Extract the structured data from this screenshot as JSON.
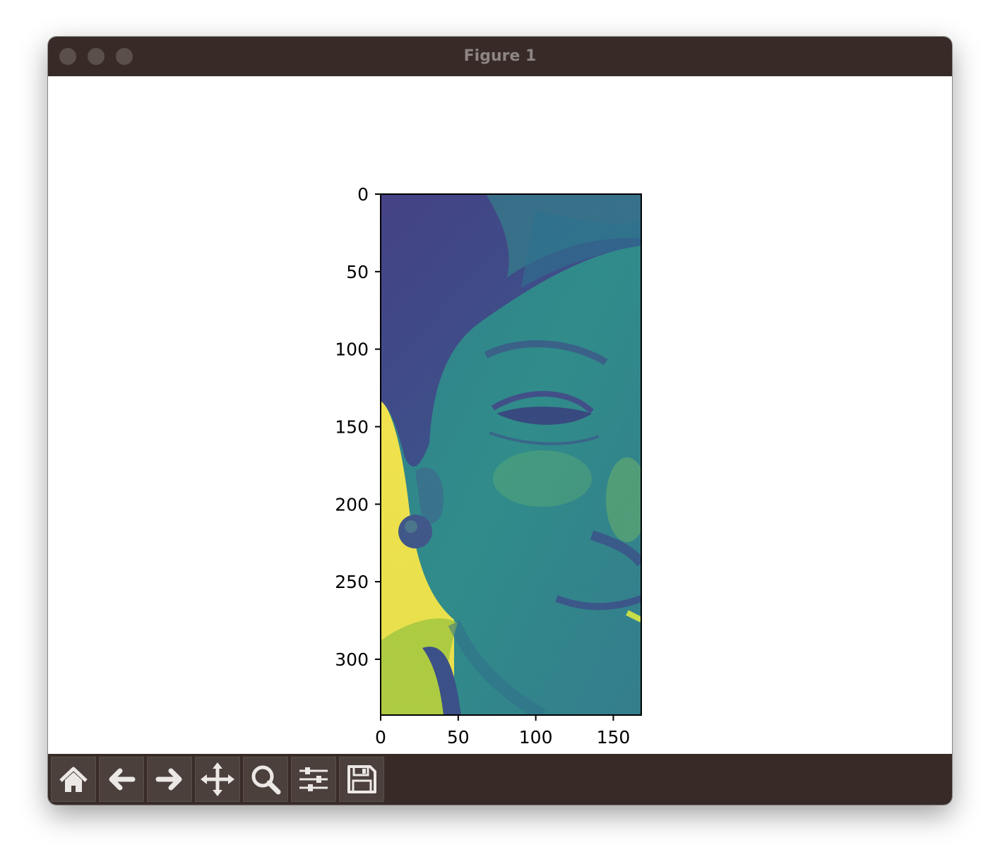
{
  "window": {
    "title": "Figure 1"
  },
  "chart_data": {
    "type": "image",
    "colormap": "viridis",
    "image_shape": [
      336,
      168
    ],
    "xlim": [
      0,
      168
    ],
    "ylim": [
      336,
      0
    ],
    "xticks": [
      0,
      50,
      100,
      150
    ],
    "yticks": [
      0,
      50,
      100,
      150,
      200,
      250,
      300
    ],
    "xtick_labels": [
      "0",
      "50",
      "100",
      "150"
    ],
    "ytick_labels": [
      "0",
      "50",
      "100",
      "150",
      "200",
      "250",
      "300"
    ],
    "xlabel": "",
    "ylabel": "",
    "title": ""
  },
  "toolbar": {
    "buttons": [
      {
        "icon": "home-icon",
        "name": "home-button"
      },
      {
        "icon": "back-arrow-icon",
        "name": "back-button"
      },
      {
        "icon": "forward-arrow-icon",
        "name": "forward-button"
      },
      {
        "icon": "move-icon",
        "name": "pan-button"
      },
      {
        "icon": "magnifier-icon",
        "name": "zoom-button"
      },
      {
        "icon": "sliders-icon",
        "name": "configure-subplots-button"
      },
      {
        "icon": "floppy-disk-icon",
        "name": "save-button"
      }
    ]
  },
  "colors": {
    "titlebar": "#382b27",
    "toolbar": "#382b27",
    "button": "#4b403c",
    "viridis_dark": "#3e3c80",
    "viridis_mid": "#2f8b8a",
    "viridis_light": "#f2e34a"
  }
}
